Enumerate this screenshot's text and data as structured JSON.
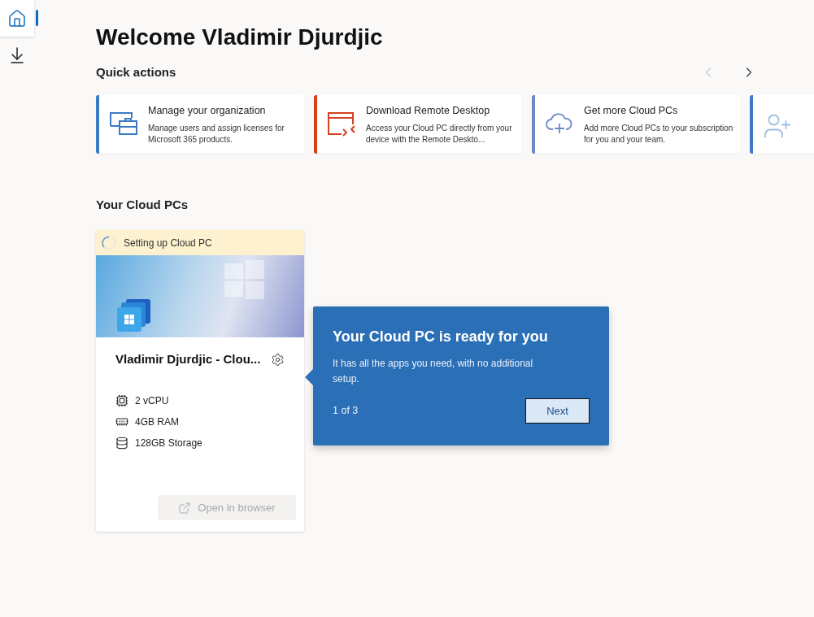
{
  "sidebar": {
    "items": [
      {
        "kind": "home",
        "selected": true
      },
      {
        "kind": "download",
        "selected": false
      }
    ]
  },
  "title": "Welcome Vladimir Djurdjic",
  "quick_actions": {
    "heading": "Quick actions",
    "prev_disabled": true,
    "next_disabled": false,
    "cards": [
      {
        "kind": "organization",
        "color": "#3b7bc4",
        "title": "Manage your organization",
        "description": "Manage users and assign licenses for Microsoft 365 products."
      },
      {
        "kind": "remote",
        "color": "#d5401f",
        "title": "Download Remote Desktop",
        "description": "Access your Cloud PC directly from your device with the Remote Deskto..."
      },
      {
        "kind": "cloud",
        "color": "#6a89c6",
        "title": "Get more Cloud PCs",
        "description": "Add more Cloud PCs to your subscription for you and your team."
      },
      {
        "kind": "user",
        "color": "#3b7bc4"
      }
    ]
  },
  "cloud_pcs": {
    "heading": "Your Cloud PCs",
    "items": [
      {
        "status": "Setting up Cloud PC",
        "name": "Vladimir Djurdjic - Clou...",
        "specs": [
          {
            "kind": "cpu",
            "text": "2 vCPU"
          },
          {
            "kind": "ram",
            "text": "4GB RAM"
          },
          {
            "kind": "storage",
            "text": "128GB Storage"
          }
        ],
        "action": {
          "label": "Open in browser",
          "disabled": true
        }
      }
    ]
  },
  "teaching_bubble": {
    "title": "Your Cloud PC is ready for you",
    "body": "It has all the apps you need, with no additional setup.",
    "step": "1 of 3",
    "button": "Next"
  }
}
